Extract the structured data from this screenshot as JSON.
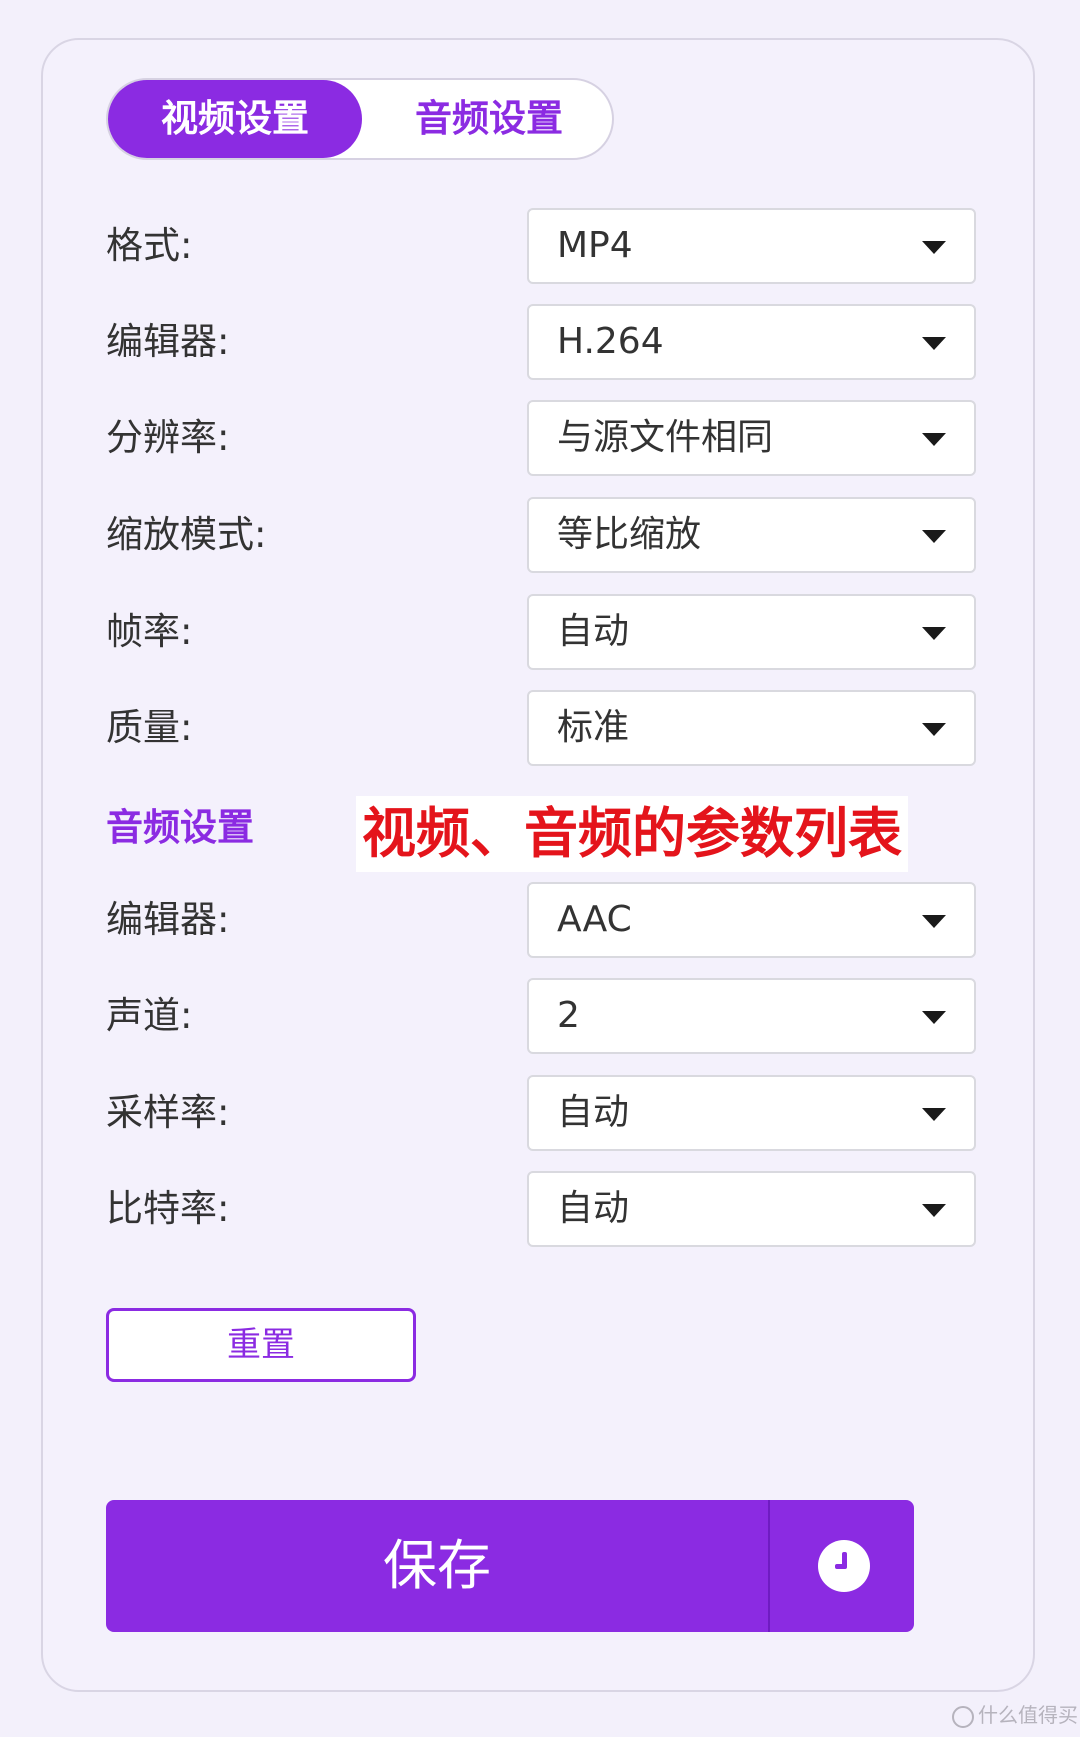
{
  "tabs": {
    "video": "视频设置",
    "audio": "音频设置"
  },
  "video_settings": [
    {
      "label": "格式:",
      "value": "MP4"
    },
    {
      "label": "编辑器:",
      "value": "H.264"
    },
    {
      "label": "分辨率:",
      "value": "与源文件相同"
    },
    {
      "label": "缩放模式:",
      "value": "等比缩放"
    },
    {
      "label": "帧率:",
      "value": "自动"
    },
    {
      "label": "质量:",
      "value": "标准"
    }
  ],
  "audio_section_title": "音频设置",
  "annotation": "视频、音频的参数列表",
  "audio_settings": [
    {
      "label": "编辑器:",
      "value": "AAC"
    },
    {
      "label": "声道:",
      "value": "2"
    },
    {
      "label": "采样率:",
      "value": "自动"
    },
    {
      "label": "比特率:",
      "value": "自动"
    }
  ],
  "buttons": {
    "reset": "重置",
    "save": "保存"
  },
  "icons": {
    "dropdown": "caret-down-icon",
    "schedule": "clock-icon"
  },
  "colors": {
    "accent": "#8b2be2",
    "annotation": "#e4141b"
  },
  "watermark": "什么值得买"
}
